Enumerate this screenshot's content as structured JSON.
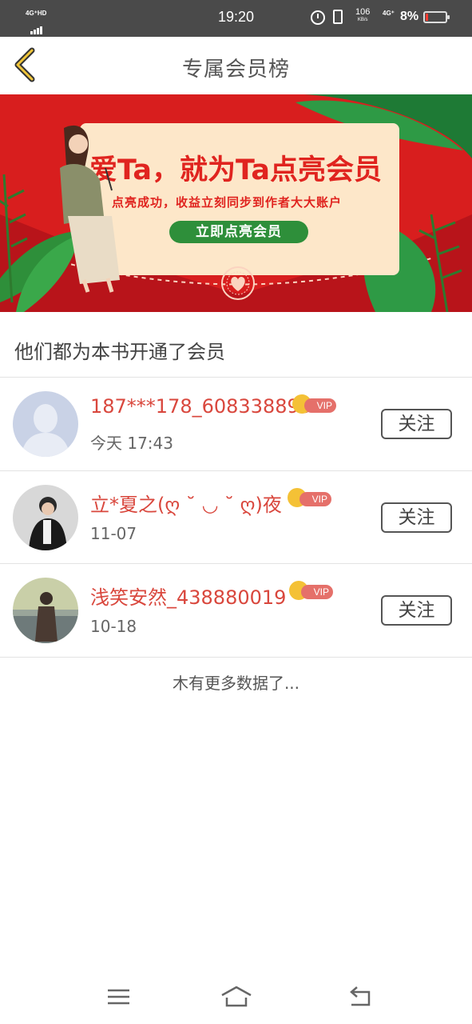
{
  "status_bar": {
    "network_label": "4G⁺HD",
    "time": "19:20",
    "speed_value": "106",
    "speed_unit": "KB/s",
    "mobile_label": "4G⁺",
    "battery_percent": "8%",
    "icons": [
      "signal-icon",
      "alarm-icon",
      "vibrate-icon",
      "battery-icon"
    ]
  },
  "header": {
    "title": "专属会员榜",
    "back_icon": "chevron-left-icon"
  },
  "banner": {
    "headline": "爱Ta，就为Ta点亮会员",
    "subtitle": "点亮成功，收益立刻同步到作者大大账户",
    "cta_label": "立即点亮会员",
    "colors": {
      "background": "#d81e1e",
      "card": "#fde7c9",
      "cta": "#2e8f3a",
      "text": "#e0241f"
    }
  },
  "section": {
    "title": "他们都为本书开通了会员"
  },
  "members": [
    {
      "name": "187***178_608338895",
      "date": "今天 17:43",
      "vip_label": "VIP",
      "follow_label": "关注",
      "avatar": "default-avatar"
    },
    {
      "name": "立*夏之(ღ ˘ ◡ ˘ ღ)夜",
      "date": "11-07",
      "vip_label": "VIP",
      "follow_label": "关注",
      "avatar": "photo-avatar"
    },
    {
      "name": "浅笑安然_438880019",
      "date": "10-18",
      "vip_label": "VIP",
      "follow_label": "关注",
      "avatar": "photo-avatar"
    }
  ],
  "footer": {
    "no_more_text": "木有更多数据了..."
  },
  "nav": {
    "icons": [
      "menu-icon",
      "home-icon",
      "back-icon"
    ]
  },
  "colors": {
    "accent_name": "#d9473d",
    "vip_pill": "#e5706a",
    "crown": "#f4c136"
  }
}
